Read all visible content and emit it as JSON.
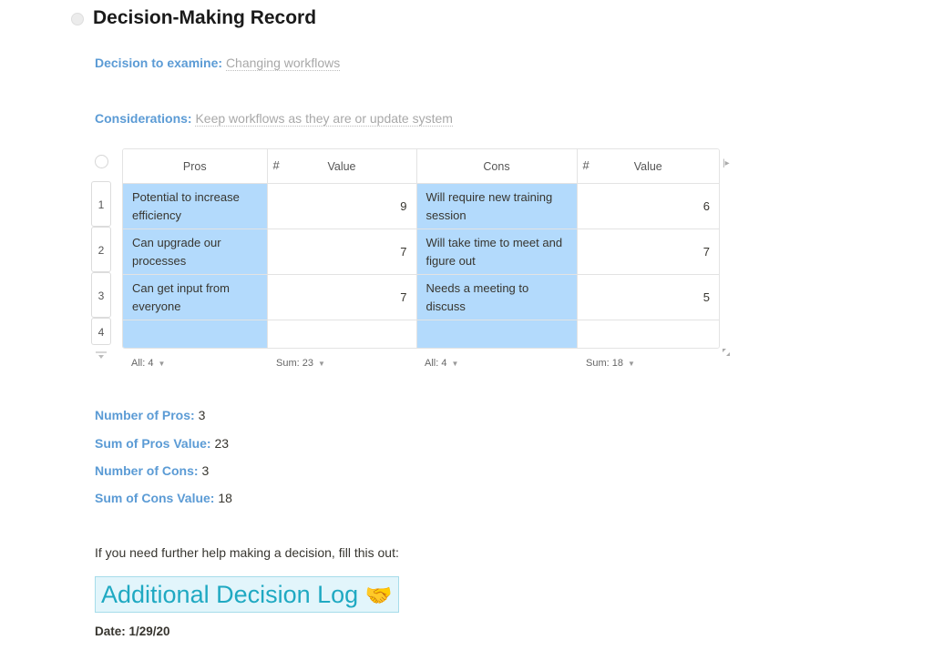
{
  "page": {
    "title": "Decision-Making Record"
  },
  "fields": {
    "decision": {
      "label": "Decision to examine:",
      "value": "Changing workflows"
    },
    "considerations": {
      "label": "Considerations:",
      "value": "Keep workflows as they are or update system"
    }
  },
  "table": {
    "columns": [
      {
        "label": "Pros",
        "type": "text"
      },
      {
        "label": "Value",
        "type": "number",
        "type_icon": "#"
      },
      {
        "label": "Cons",
        "type": "text"
      },
      {
        "label": "Value",
        "type": "number",
        "type_icon": "#"
      }
    ],
    "rows": [
      {
        "num": "1",
        "pro": "Potential to increase efficiency",
        "pro_value": "9",
        "con": "Will require new training session",
        "con_value": "6"
      },
      {
        "num": "2",
        "pro": "Can upgrade our processes",
        "pro_value": "7",
        "con": "Will take time to meet and figure out",
        "con_value": "7"
      },
      {
        "num": "3",
        "pro": "Can get input from everyone",
        "pro_value": "7",
        "con": "Needs a meeting to discuss",
        "con_value": "5"
      },
      {
        "num": "4",
        "pro": "",
        "pro_value": "",
        "con": "",
        "con_value": ""
      }
    ],
    "footer": [
      "All: 4",
      "Sum: 23",
      "All: 4",
      "Sum: 18"
    ]
  },
  "summary": [
    {
      "label": "Number of Pros:",
      "value": "3"
    },
    {
      "label": "Sum of Pros Value:",
      "value": "23"
    },
    {
      "label": "Number of Cons:",
      "value": "3"
    },
    {
      "label": "Sum of Cons Value:",
      "value": "18"
    }
  ],
  "help_text": "If you need further help making a decision, fill this out:",
  "banner": {
    "text": "Additional Decision Log",
    "emoji": "🤝"
  },
  "date": "Date: 1/29/20",
  "colors": {
    "label_blue": "#5b9bd5",
    "cell_highlight": "#b3dafc",
    "banner_text": "#1fa9c2",
    "banner_bg": "#e2f5fb"
  }
}
